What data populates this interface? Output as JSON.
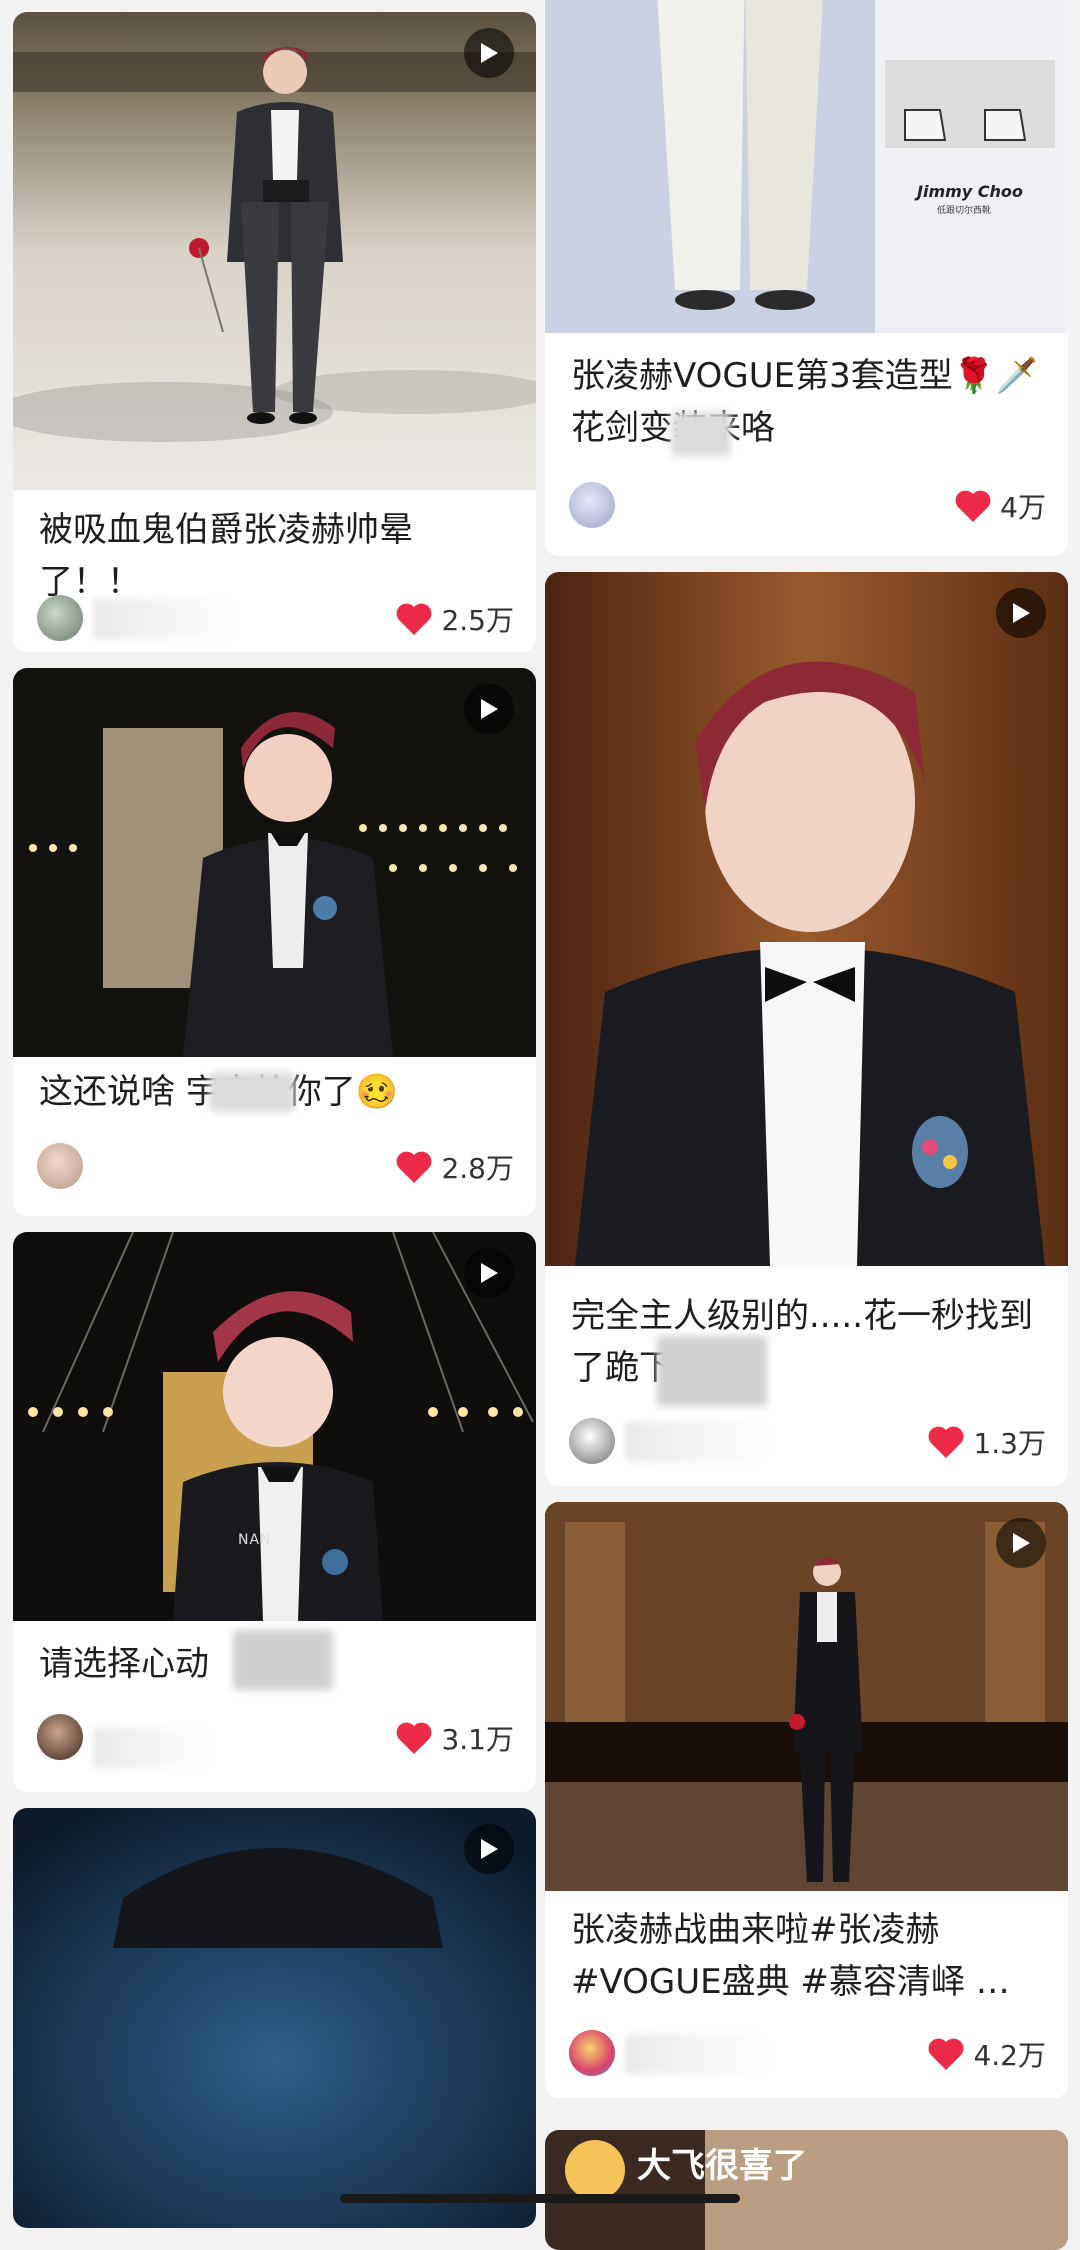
{
  "feed": {
    "left": [
      {
        "title": "被吸血鬼伯爵张凌赫帅晕了！！",
        "likes": "2.5万"
      },
      {
        "title": "这还说啥 宇宙给你了🥴",
        "likes": "2.8万"
      },
      {
        "title": "请选择心动",
        "likes": "3.1万",
        "watermark": "NAN"
      },
      {
        "title": ""
      }
    ],
    "right": [
      {
        "title": "张凌赫VOGUE第3套造型🌹🗡️花剑变装来咯",
        "likes": "4万",
        "brand": "Jimmy Choo",
        "brand_sub": "低跟切尔西靴"
      },
      {
        "title": "完全主人级别的.....花一秒找到了跪下的位",
        "likes": "1.3万"
      },
      {
        "title": "张凌赫战曲来啦#张凌赫 #VOGUE盛典 #慕容清峄 …",
        "likes": "4.2万"
      },
      {
        "title": "大飞很喜了"
      }
    ]
  },
  "colors": {
    "heart": "#ee2a4a",
    "page_bg": "#f2f2f2"
  },
  "icons": {
    "play": "play-icon",
    "like": "heart-icon"
  }
}
